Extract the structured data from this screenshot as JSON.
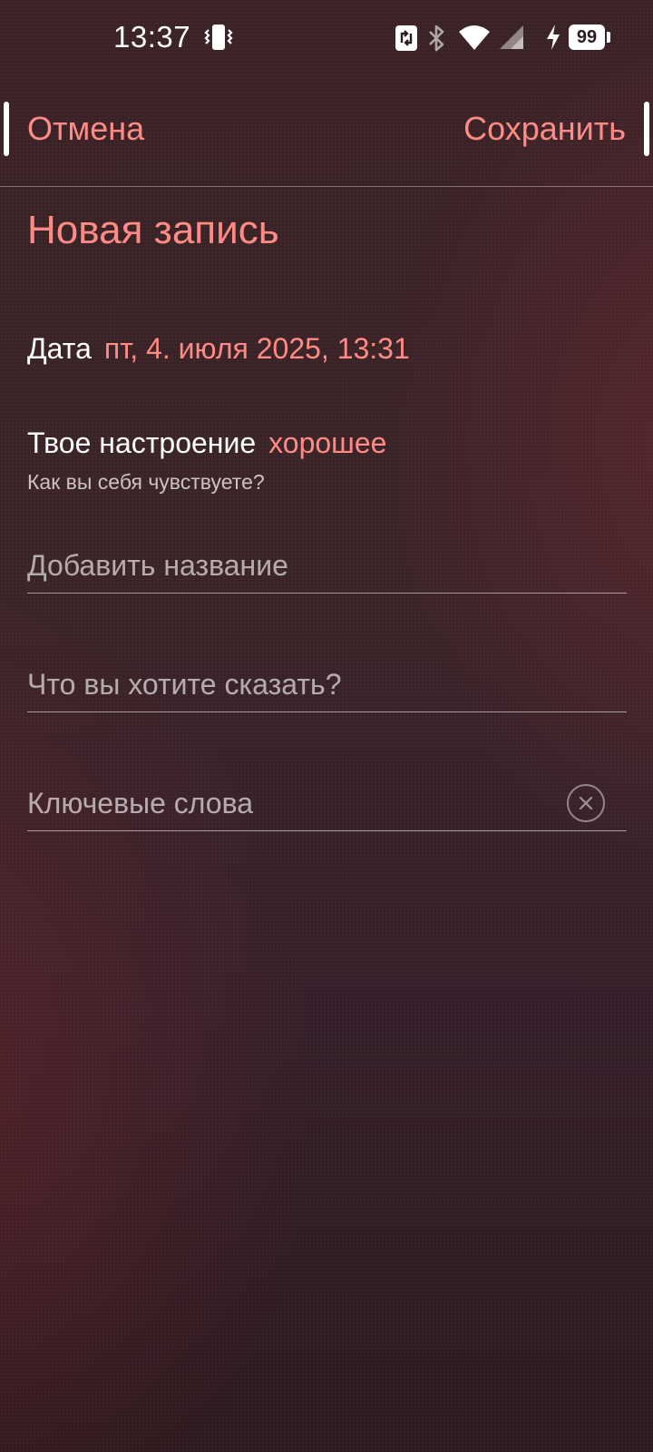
{
  "status_bar": {
    "time": "13:37",
    "battery_level": "99",
    "icons": [
      "vibrate-icon",
      "nfc-icon",
      "bluetooth-icon",
      "wifi-icon",
      "signal-icon",
      "charging-icon",
      "battery-icon"
    ]
  },
  "header": {
    "cancel_label": "Отмена",
    "save_label": "Сохранить"
  },
  "page": {
    "title": "Новая запись"
  },
  "entry": {
    "date_label": "Дата",
    "date_value": "пт, 4. июля 2025, 13:31",
    "mood_label": "Твое настроение",
    "mood_value": "хорошее",
    "mood_hint": "Как вы себя чувствуете?"
  },
  "fields": {
    "title_placeholder": "Добавить название",
    "text_placeholder": "Что вы хотите сказать?",
    "keywords_placeholder": "Ключевые слова",
    "clear_icon": "clear-circle-icon"
  },
  "colors": {
    "accent": "#ff8a84",
    "background": "#3a2226"
  }
}
